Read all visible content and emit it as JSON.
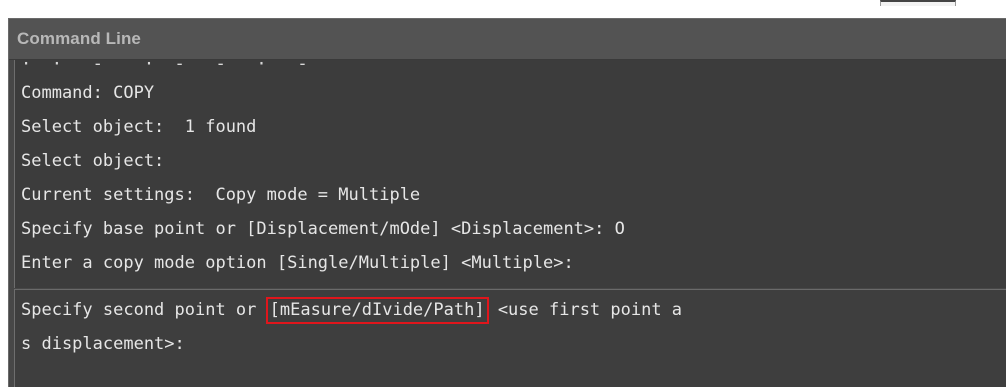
{
  "panel": {
    "title": "Command Line"
  },
  "history": {
    "cut_line": "·  ·   -    ·  -   -   ·   -",
    "lines": [
      "Command: COPY",
      "Select object:  1 found",
      "Select object:",
      "Current settings:  Copy mode = Multiple",
      "Specify base point or [Displacement/mOde] <Displacement>: O",
      "Enter a copy mode option [Single/Multiple] <Multiple>:"
    ]
  },
  "prompt": {
    "before": "Specify second point or ",
    "options": "[mEasure/dIvide/Path]",
    "after": " <use first point a",
    "continuation": "s displacement>:"
  },
  "colors": {
    "panel_bg": "#474747",
    "text": "#e6e6e6",
    "title": "#b8b8b8",
    "highlight_border": "#e0161c"
  }
}
